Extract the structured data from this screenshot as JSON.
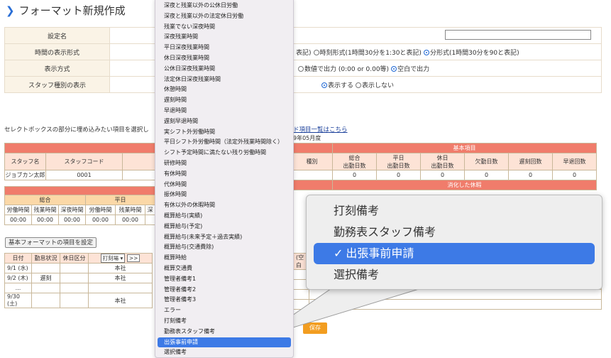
{
  "page": {
    "title": "フォーマット新規作成"
  },
  "settings": {
    "name_label": "設定名",
    "time_format_label": "時間の表示形式",
    "time_format_tail": "表記)",
    "opt_hour": "時刻形式(1時間30分を1:30と表記)",
    "opt_minute": "分形式(1時間30分を90と表記)",
    "display_label": "表示方式",
    "opt_numeric": "数値で出力 (0:00 or 0.00等)",
    "opt_blank": "空白で出力",
    "staff_type_label": "スタッフ種別の表示",
    "opt_show": "表示する",
    "opt_hide": "表示しない"
  },
  "notice": {
    "text": "セレクトボックスの部分に埋め込みたい項目を選択し",
    "link": "ド項目一覧はこちら",
    "month": "9年05月度"
  },
  "grid": {
    "basic_header": "基本項目",
    "col_staff": "スタッフ名",
    "col_code": "スタッフコード",
    "col_type": "種別",
    "col_total": "総合\n出勤日数",
    "col_weekday": "平日\n出勤日数",
    "col_holiday": "休日\n出勤日数",
    "col_absent": "欠勤日数",
    "col_late": "遅刻回数",
    "col_early": "早退回数",
    "row_name": "ジョブカン太郎",
    "row_code": "0001",
    "zero": "0",
    "used_leave": "消化した休暇",
    "sub_total": "総合",
    "sub_weekday": "平日",
    "w1": "労働時間",
    "w2": "残業時間",
    "w3": "深夜時間",
    "w4": "労働時間",
    "w5": "残業時間",
    "w6": "深",
    "t": "00:00"
  },
  "reset_label": "基本フォーマットの項目を設定",
  "template": {
    "h_date": "日付",
    "h_status": "勤怠状況",
    "h_holiday": "休日区分",
    "select_val": "打刻場",
    "more": ">>",
    "blank_label": "(空白",
    "rows": [
      {
        "date": "9/1 (水)",
        "status": "",
        "place": "本社"
      },
      {
        "date": "9/2 (木)",
        "status": "遅刻",
        "place": "本社"
      },
      {
        "date": "...",
        "status": "",
        "place": ""
      },
      {
        "date": "9/30 (土)",
        "status": "",
        "place": "本社"
      }
    ]
  },
  "save_label": "保存",
  "dropdown": {
    "items": [
      "深夜と残業以外の公休日労働",
      "深夜と残業以外の法定休日労働",
      "残業でない深夜時間",
      "深夜残業時間",
      "平日深夜残業時間",
      "休日深夜残業時間",
      "公休日深夜残業時間",
      "法定休日深夜残業時間",
      "休憩時間",
      "遅刻時間",
      "早退時間",
      "遅刻早退時間",
      "実シフト外労働時間",
      "平日シフト外労働時間（法定外残業時間除く）",
      "シフト予定時間に満たない残り労働時間",
      "研修時間",
      "有休時間",
      "代休時間",
      "振休時間",
      "有休以外の休暇時間",
      "概算給与(実績)",
      "概算給与(予定)",
      "概算給与(未来予定＋過去実績)",
      "概算給与(交通費除)",
      "概算時給",
      "概算交通費",
      "管理者備考1",
      "管理者備考2",
      "管理者備考3",
      "エラー",
      "打刻備考",
      "勤務表スタッフ備考",
      "出張事前申請",
      "選択備考"
    ],
    "selected_index": 32
  },
  "zoom": {
    "items": [
      "打刻備考",
      "勤務表スタッフ備考",
      "出張事前申請",
      "選択備考"
    ],
    "selected_index": 2,
    "check": "✓"
  }
}
